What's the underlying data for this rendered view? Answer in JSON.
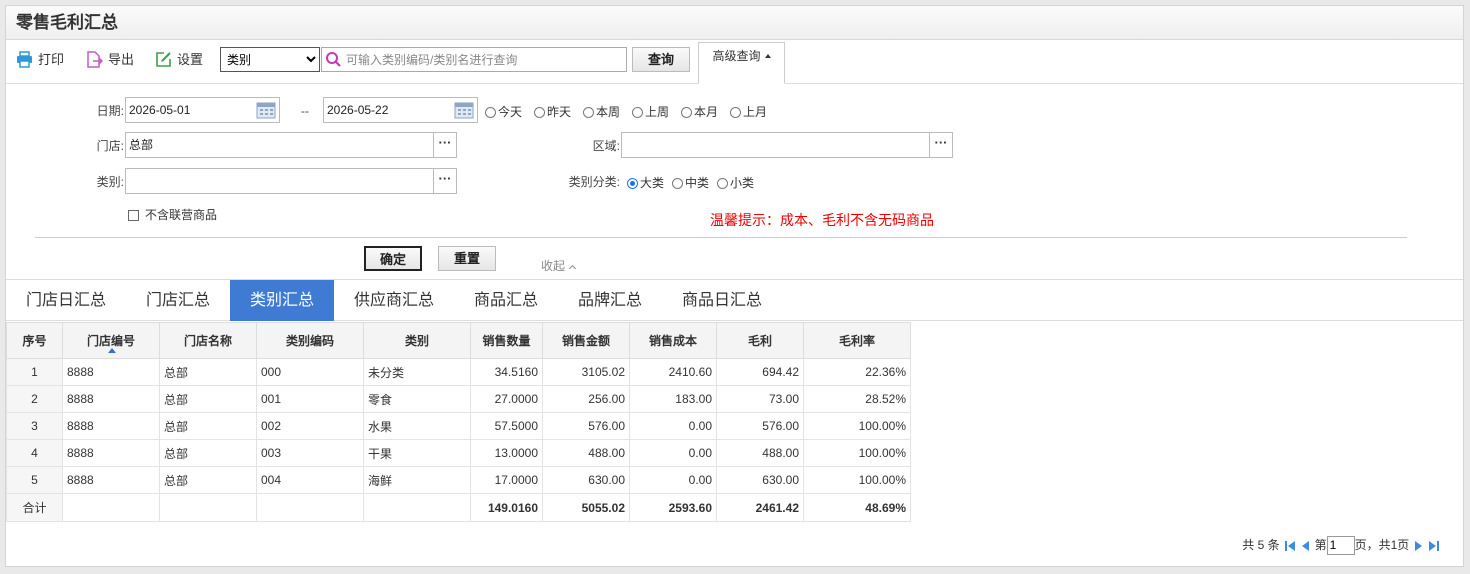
{
  "window": {
    "title": "零售毛利汇总"
  },
  "toolbar": {
    "print_label": "打印",
    "export_label": "导出",
    "settings_label": "设置",
    "category_select": {
      "value": "类别",
      "options": [
        "类别"
      ]
    },
    "search_placeholder": "可输入类别编码/类别名进行查询",
    "query_label": "查询",
    "advanced_label": "高级查询"
  },
  "filters": {
    "date_label": "日期:",
    "date_from": "2026-05-01",
    "date_sep": "--",
    "date_to": "2026-05-22",
    "date_quick": [
      "今天",
      "昨天",
      "本周",
      "上周",
      "本月",
      "上月"
    ],
    "store_label": "门店:",
    "store_value": "总部",
    "region_label": "区域:",
    "region_value": "",
    "category_label": "类别:",
    "category_value": "",
    "cat_level_label": "类别分类:",
    "cat_levels": [
      "大类",
      "中类",
      "小类"
    ],
    "cat_level_selected": "大类",
    "exclude_joint_label": "不含联营商品",
    "tip": "温馨提示：成本、毛利不含无码商品",
    "ok_label": "确定",
    "reset_label": "重置",
    "collapse_label": "收起"
  },
  "tabs": [
    "门店日汇总",
    "门店汇总",
    "类别汇总",
    "供应商汇总",
    "商品汇总",
    "品牌汇总",
    "商品日汇总"
  ],
  "active_tab": "类别汇总",
  "table": {
    "columns": [
      "序号",
      "门店编号",
      "门店名称",
      "类别编码",
      "类别",
      "销售数量",
      "销售金额",
      "销售成本",
      "毛利",
      "毛利率"
    ],
    "rows": [
      [
        "1",
        "8888",
        "总部",
        "000",
        "未分类",
        "34.5160",
        "3105.02",
        "2410.60",
        "694.42",
        "22.36%"
      ],
      [
        "2",
        "8888",
        "总部",
        "001",
        "零食",
        "27.0000",
        "256.00",
        "183.00",
        "73.00",
        "28.52%"
      ],
      [
        "3",
        "8888",
        "总部",
        "002",
        "水果",
        "57.5000",
        "576.00",
        "0.00",
        "576.00",
        "100.00%"
      ],
      [
        "4",
        "8888",
        "总部",
        "003",
        "干果",
        "13.0000",
        "488.00",
        "0.00",
        "488.00",
        "100.00%"
      ],
      [
        "5",
        "8888",
        "总部",
        "004",
        "海鲜",
        "17.0000",
        "630.00",
        "0.00",
        "630.00",
        "100.00%"
      ]
    ],
    "total": [
      "合计",
      "",
      "",
      "",
      "",
      "149.0160",
      "5055.02",
      "2593.60",
      "2461.42",
      "48.69%"
    ]
  },
  "pager": {
    "total_text": "共 5 条",
    "page_prefix": "第",
    "page_value": "1",
    "page_suffix": "页，共1页"
  },
  "colors": {
    "accent": "#3f7ad3",
    "tip": "#e00000",
    "print_icon": "#2a9ad8",
    "export_icon": "#c05bc7",
    "settings_icon": "#3aa14a"
  },
  "icons": [
    "printer-icon",
    "export-icon",
    "settings-icon",
    "search-icon",
    "calendar-icon",
    "ellipsis-icon",
    "first-page-icon",
    "prev-page-icon",
    "next-page-icon",
    "last-page-icon"
  ]
}
